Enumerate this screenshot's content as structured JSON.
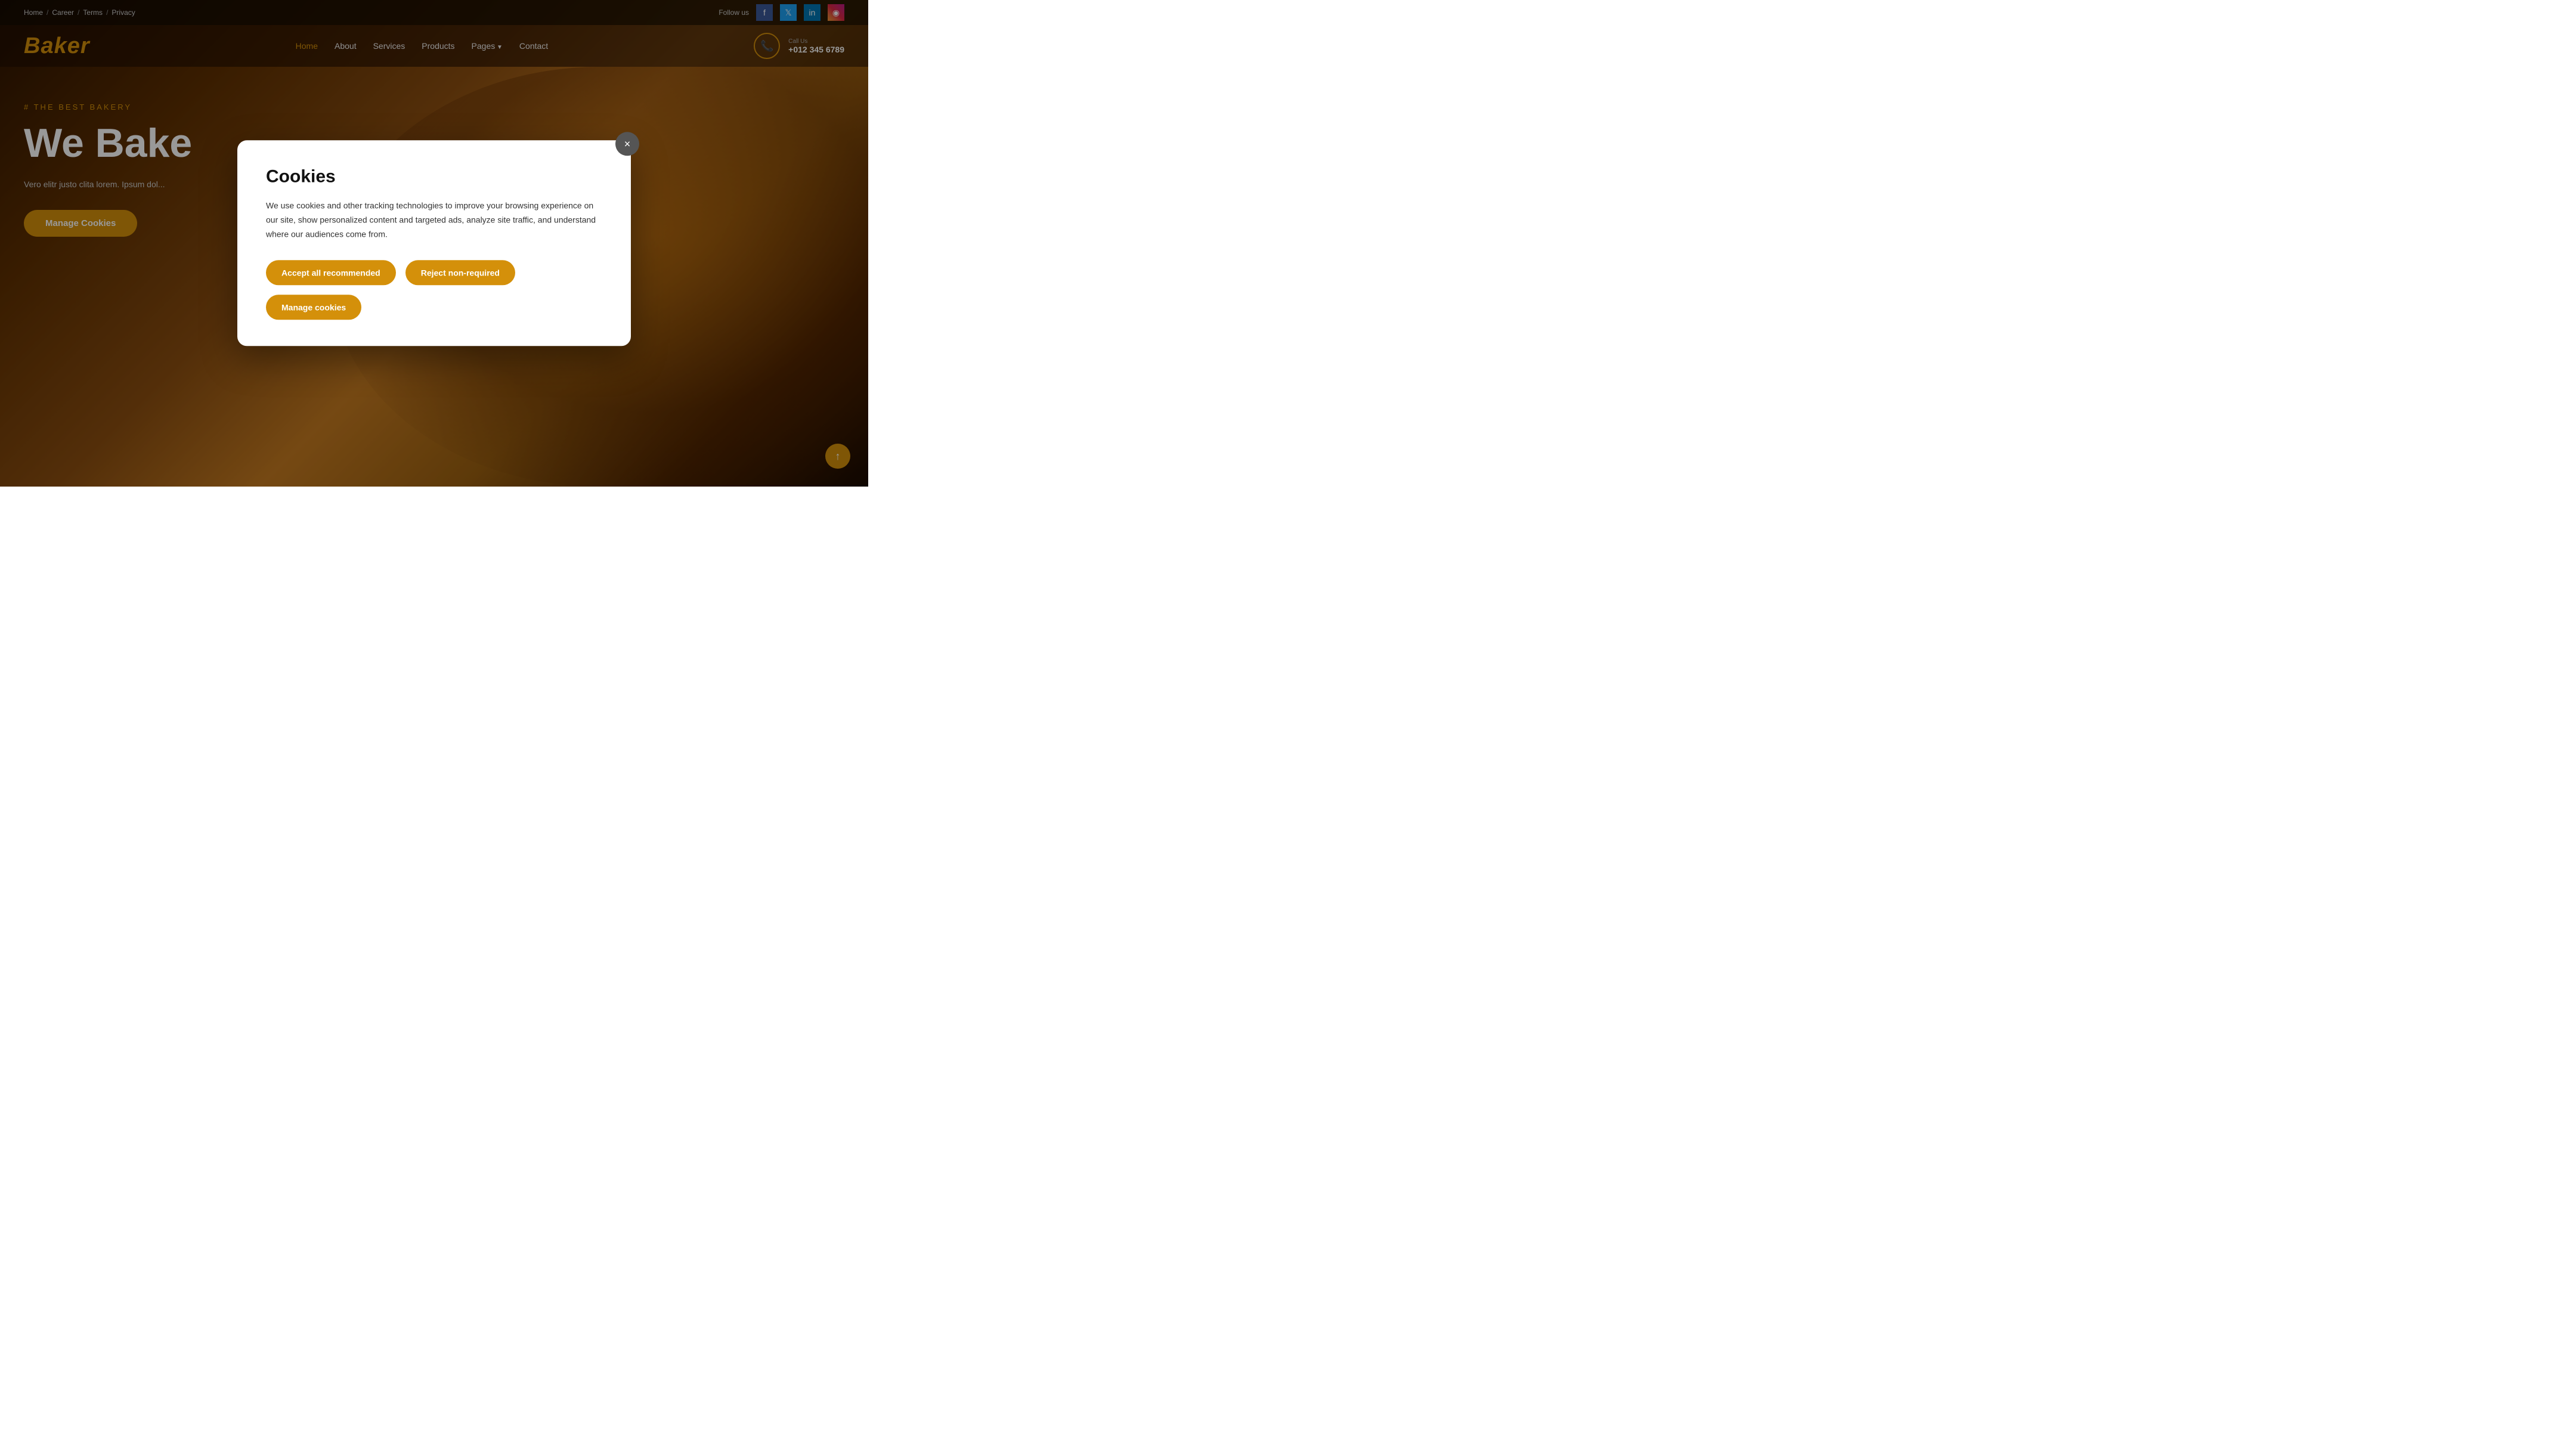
{
  "topbar": {
    "links": [
      {
        "label": "Home",
        "sep": true
      },
      {
        "label": "Career",
        "sep": true
      },
      {
        "label": "Terms",
        "sep": true
      },
      {
        "label": "Privacy",
        "sep": false
      }
    ],
    "follow_label": "Follow us",
    "social": [
      {
        "name": "facebook",
        "icon": "f",
        "class": "facebook"
      },
      {
        "name": "twitter",
        "icon": "𝕏",
        "class": "twitter"
      },
      {
        "name": "linkedin",
        "icon": "in",
        "class": "linkedin"
      },
      {
        "name": "instagram",
        "icon": "◉",
        "class": "instagram"
      }
    ]
  },
  "nav": {
    "logo": "Baker",
    "links": [
      {
        "label": "Home",
        "active": true
      },
      {
        "label": "About",
        "active": false
      },
      {
        "label": "Services",
        "active": false
      },
      {
        "label": "Products",
        "active": false
      },
      {
        "label": "Pages",
        "active": false,
        "dropdown": true
      },
      {
        "label": "Contact",
        "active": false
      }
    ],
    "call_label": "Call Us",
    "call_number": "+012 345 6789"
  },
  "hero": {
    "tag": "THE BEST BAKERY",
    "title": "We Bake",
    "subtitle": "Vero elitr justo clita lorem. Ipsum dol...",
    "manage_cookies_btn": "Manage Cookies"
  },
  "cookie_modal": {
    "title": "Cookies",
    "text": "We use cookies and other tracking technologies to improve your browsing experience on our site, show personalized content and targeted ads, analyze site traffic, and understand where our audiences come from.",
    "close_label": "×",
    "buttons": [
      {
        "label": "Accept all recommended",
        "key": "accept"
      },
      {
        "label": "Reject non-required",
        "key": "reject"
      },
      {
        "label": "Manage cookies",
        "key": "manage"
      }
    ]
  },
  "scroll_up": {
    "icon": "↑"
  }
}
